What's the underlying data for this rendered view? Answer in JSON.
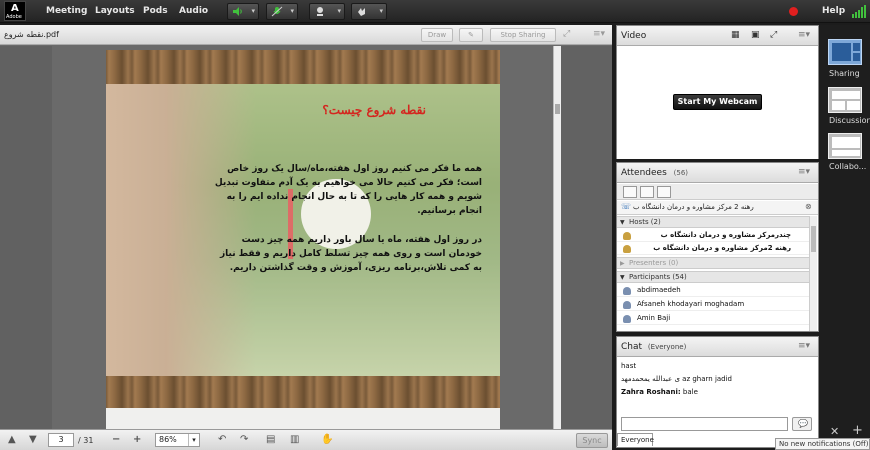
{
  "topbar": {
    "logo": "Adobe",
    "menus": [
      "Meeting",
      "Layouts",
      "Pods",
      "Audio"
    ],
    "help": "Help",
    "icons": [
      "speaker-icon",
      "microphone-icon",
      "webcam-icon",
      "raise-hand-icon"
    ],
    "colors": {
      "audio_on": "#41c13d",
      "recording": "#e01f1f"
    }
  },
  "share_pod": {
    "file_name": "نقطه شروع.pdf",
    "draw_label": "Draw",
    "stop_sharing_label": "Stop Sharing",
    "slide": {
      "title": "نقطه شروع چیست؟",
      "paragraph1": "همه ما فکر می کنیم روز اول هفته،ماه/سال یک روز خاص است؛ فکر می کنیم حالا می خواهیم به یک آدم متفاوت تبدیل شویم و همه کار هایی را که تا به حال انجام نداده ایم را به انجام برسانیم.",
      "paragraph2": "در روز اول هفته، ماه یا سال باور داریم همه چیز دست خودمان است و روی همه چیز تسلط کامل داریم و فقط نیاز به کمی تلاش،برنامه ریزی، آموزش و وقت گذاشتن داریم."
    },
    "toolbar": {
      "page_current": "3",
      "page_total": "/ 31",
      "zoom": "86%",
      "sync_label": "Sync"
    }
  },
  "video_pod": {
    "title": "Video",
    "start_webcam_label": "Start My Webcam"
  },
  "attendees_pod": {
    "title": "Attendees",
    "count": "(56)",
    "status_line": "رهنه 2 مرکز مشاوره و درمان دانشگاه ب",
    "hosts_header": "Hosts (2)",
    "hosts": [
      "چندرمرکز مشاوره و درمان دانشگاه ب",
      "رهنه 2مرکز مشاوره و درمان دانشگاه ب"
    ],
    "presenters_header": "Presenters (0)",
    "participants_header": "Participants (54)",
    "participants": [
      "abdimaedeh",
      "Afsaneh khodayari moghadam",
      "Amin Baji"
    ]
  },
  "chat_pod": {
    "title": "Chat",
    "scope": "(Everyone)",
    "messages": [
      {
        "text": "hast"
      },
      {
        "text": "ی عبدالله یمحمدمهد az gharn jadid"
      },
      {
        "sender": "Zahra Roshani:",
        "text": "bale"
      }
    ],
    "tab_label": "Everyone"
  },
  "layouts": {
    "items": [
      "Sharing",
      "Discussion",
      "Collabo..."
    ],
    "selected": "Sharing"
  },
  "notification": "No new notifications (Off)"
}
